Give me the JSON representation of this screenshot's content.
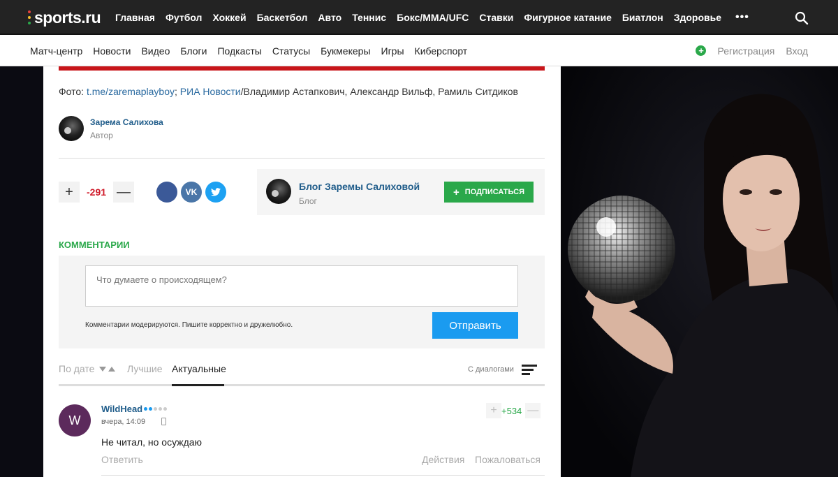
{
  "header": {
    "logo": "sports.ru",
    "nav": [
      "Главная",
      "Футбол",
      "Хоккей",
      "Баскетбол",
      "Авто",
      "Теннис",
      "Бокс/MMA/UFC",
      "Ставки",
      "Фигурное катание",
      "Биатлон",
      "Здоровье"
    ],
    "more": "•••"
  },
  "subnav": {
    "items": [
      "Матч-центр",
      "Новости",
      "Видео",
      "Блоги",
      "Подкасты",
      "Статусы",
      "Букмекеры",
      "Игры",
      "Киберспорт"
    ],
    "register": "Регистрация",
    "login": "Вход",
    "plus": "+"
  },
  "article": {
    "photo_prefix": "Фото: ",
    "photo_link1": "t.me/zaremaplayboy",
    "photo_sep": "; ",
    "photo_link2": "РИА Новости",
    "photo_rest": "/Владимир Астапкович, Александр Вильф, Рамиль Ситдиков",
    "author_name": "Зарема Салихова",
    "author_role": "Автор",
    "vote_plus": "+",
    "vote_count": "-291",
    "vote_minus": "—"
  },
  "social": {
    "vk": "VK"
  },
  "blog": {
    "name": "Блог Заремы Салиховой",
    "sub": "Блог",
    "subscribe": "ПОДПИСАТЬСЯ",
    "subscribe_plus": "+"
  },
  "comments": {
    "title": "КОММЕНТАРИИ",
    "placeholder": "Что думаете о происходящем?",
    "moderation_note": "Комментарии модерируются. Пишите корректно и дружелюбно.",
    "send": "Отправить",
    "sort_date": "По дате",
    "sort_best": "Лучшие",
    "sort_actual": "Актуальные",
    "dialogs": "С диалогами"
  },
  "comment_items": [
    {
      "avatar_letter": "W",
      "name": "WildHead",
      "time": "вчера, 14:09",
      "text": "Не читал, но осуждаю",
      "score": "+534",
      "vote_plus": "+",
      "vote_minus": "—",
      "reply": "Ответить",
      "actions": "Действия",
      "report": "Пожаловаться"
    }
  ],
  "colors": {
    "accent_green": "#2aa84a",
    "link_blue": "#1f5c8a",
    "negative_red": "#d01c2b",
    "button_blue": "#1a9bf0"
  }
}
